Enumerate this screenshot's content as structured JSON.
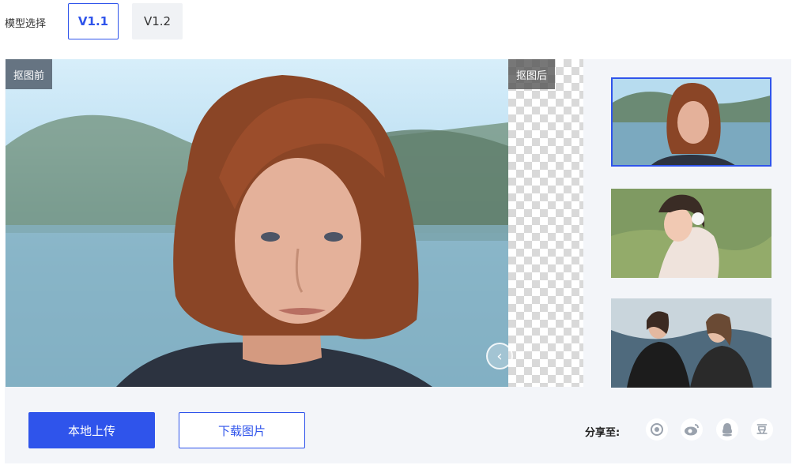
{
  "model": {
    "label": "模型选择",
    "versions": [
      {
        "label": "V1.1",
        "selected": true
      },
      {
        "label": "V1.2",
        "selected": false
      }
    ]
  },
  "preview": {
    "before_label": "抠图前",
    "after_label": "抠图后",
    "slider_icon": "chevron-left-icon"
  },
  "thumbnails": [
    {
      "name": "woman-red-hair-portrait",
      "selected": true
    },
    {
      "name": "girl-with-headphones",
      "selected": false
    },
    {
      "name": "two-friends-outdoors",
      "selected": false
    }
  ],
  "actions": {
    "upload_label": "本地上传",
    "download_label": "下载图片"
  },
  "share": {
    "label": "分享至:",
    "icons": [
      "camera-aperture-icon",
      "weibo-icon",
      "qq-icon",
      "douban-icon"
    ],
    "douban_glyph": "豆"
  },
  "colors": {
    "accent": "#2f54eb",
    "panel_bg": "#f3f5f9"
  }
}
